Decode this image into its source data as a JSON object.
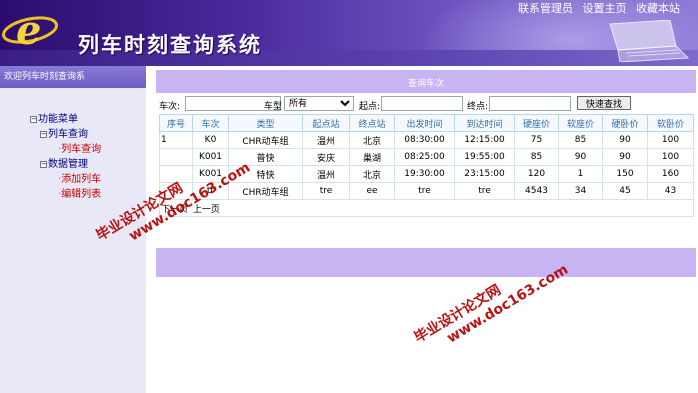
{
  "header": {
    "title": "列车时刻查询系统",
    "links": [
      "联系管理员",
      "设置主页",
      "收藏本站"
    ]
  },
  "sidebar": {
    "welcome": "欢迎列车时刻查询系",
    "tree": {
      "root": "功能菜单",
      "groups": [
        {
          "label": "列车查询",
          "items": [
            "列车查询"
          ]
        },
        {
          "label": "数据管理",
          "items": [
            "添加列车",
            "编辑列表"
          ]
        }
      ]
    }
  },
  "main": {
    "panel_title": "查询车次",
    "search": {
      "train_no_label": "车次:",
      "train_no_value": "",
      "type_label": "车型",
      "type_selected": "所有",
      "start_label": "起点:",
      "start_value": "",
      "end_label": "终点:",
      "end_value": "",
      "button_label": "快速查找"
    },
    "table": {
      "columns": [
        "序号",
        "车次",
        "类型",
        "起点站",
        "终点站",
        "出发时间",
        "到达时间",
        "硬座价",
        "软座价",
        "硬卧价",
        "软卧价"
      ],
      "rows": [
        [
          "1",
          "K0",
          "CHR动车组",
          "温州",
          "北京",
          "08:30:00",
          "12:15:00",
          "75",
          "85",
          "90",
          "100"
        ],
        [
          "",
          "K001",
          "普快",
          "安庆",
          "巢湖",
          "08:25:00",
          "19:55:00",
          "85",
          "90",
          "90",
          "100"
        ],
        [
          "",
          "K001",
          "特快",
          "温州",
          "北京",
          "19:30:00",
          "23:15:00",
          "120",
          "1",
          "150",
          "160"
        ],
        [
          "",
          "tr",
          "CHR动车组",
          "tre",
          "ee",
          "tre",
          "tre",
          "4543",
          "34",
          "45",
          "43"
        ]
      ],
      "pager": {
        "next": "下一页",
        "prev": "上一页"
      }
    }
  },
  "watermarks": [
    {
      "cn": "毕业设计论文网",
      "url": "www.doc163.com"
    },
    {
      "cn": "毕业设计论文网",
      "url": "www.doc163.com"
    }
  ],
  "colors": {
    "header_dark": "#2a0c6e",
    "header_light": "#8e7ad6",
    "panel_bar": "#c8b4f2",
    "sidebar_bg": "#e8e8f7",
    "watermark": "#b50000",
    "table_header_text": "#2f6fa8"
  }
}
